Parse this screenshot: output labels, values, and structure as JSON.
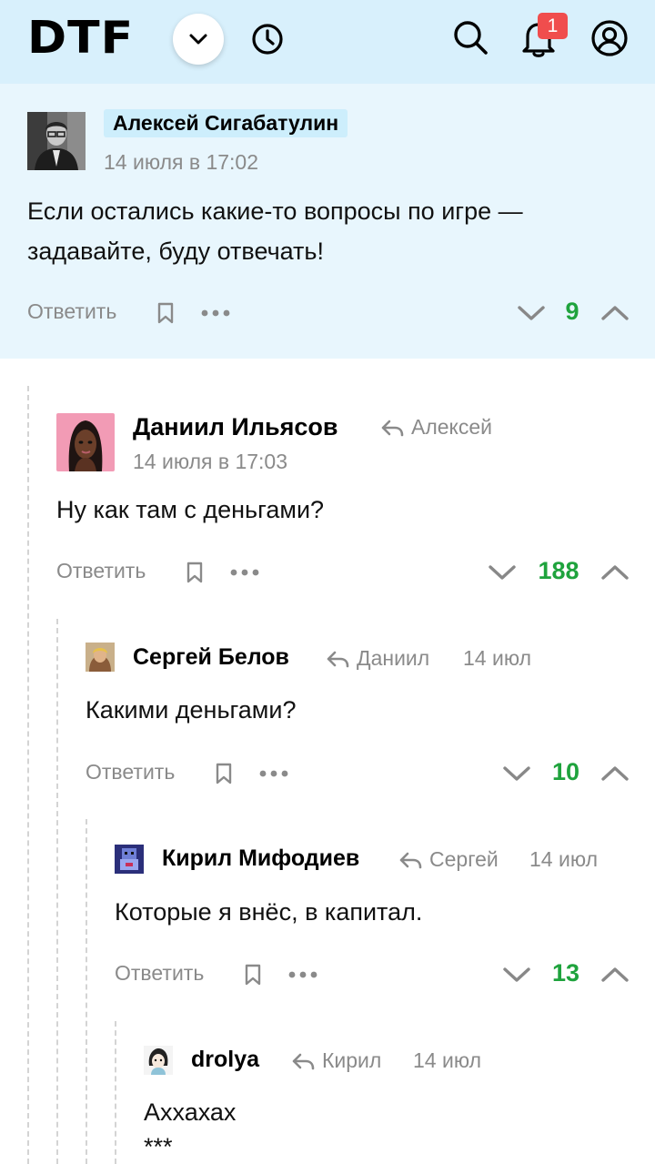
{
  "header": {
    "logo": "DTF",
    "notifications_count": "1",
    "icons": [
      "chevron-down-icon",
      "clock-icon",
      "search-icon",
      "bell-icon",
      "user-circle-icon"
    ]
  },
  "actions": {
    "reply_label": "Ответить"
  },
  "comments": [
    {
      "author": "Алексей Сигабатулин",
      "date": "14 июля в 17:02",
      "text_line1": "Если остались какие-то вопросы по игре —",
      "text_line2": "задавайте, буду отвечать!",
      "rating": "9"
    },
    {
      "author": "Даниил Ильясов",
      "reply_to": "Алексей",
      "date": "14 июля в 17:03",
      "text": "Ну как там с деньгами?",
      "rating": "188"
    },
    {
      "author": "Сергей Белов",
      "reply_to": "Даниил",
      "date": "14 июл",
      "text": "Какими деньгами?",
      "rating": "10"
    },
    {
      "author": "Кирил Мифодиев",
      "reply_to": "Сергей",
      "date": "14 июл",
      "text": "Которые я внёс, в капитал.",
      "rating": "13"
    },
    {
      "author": "drolya",
      "reply_to": "Кирил",
      "date": "14 июл",
      "text_line1": "Аххахах",
      "text_line2": "***"
    }
  ],
  "colors": {
    "header_bg": "#d8f0fc",
    "highlight_bg": "#e8f6fd",
    "rating_positive": "#1fa33d",
    "badge": "#f04d4d",
    "muted_text": "#8a8a8a"
  }
}
